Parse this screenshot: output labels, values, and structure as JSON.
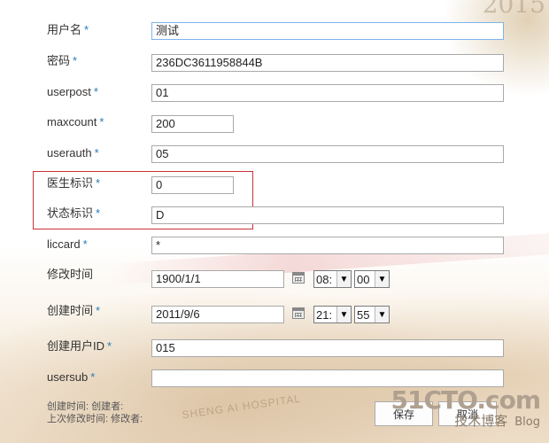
{
  "form": {
    "fields": [
      {
        "label": "用户名",
        "required": "*",
        "value": ""
      },
      {
        "label": "密码",
        "required": "*",
        "value": "236DC3611958844B"
      },
      {
        "label": "userpost",
        "required": "*",
        "value": "01"
      },
      {
        "label": "maxcount",
        "required": "*",
        "value": "200"
      },
      {
        "label": "userauth",
        "required": "*",
        "value": "05"
      },
      {
        "label": "医生标识",
        "required": "*",
        "value": "0"
      },
      {
        "label": "状态标识",
        "required": "*",
        "value": "D"
      },
      {
        "label": "liccard",
        "required": "*",
        "value": "*"
      },
      {
        "label": "修改时间",
        "required": "",
        "date": "1900/1/1",
        "hour": "08:",
        "minute": "00"
      },
      {
        "label": "创建时间",
        "required": "*",
        "date": "2011/9/6",
        "hour": "21:",
        "minute": "55"
      },
      {
        "label": "创建用户ID",
        "required": "*",
        "value": "015"
      },
      {
        "label": "usersub",
        "required": "*",
        "value": ""
      }
    ],
    "username_value": "测试"
  },
  "footer": {
    "created_line": "创建时间: 创建者:",
    "modified_line": "上次修改时间: 修改者:",
    "save_label": "保存",
    "cancel_label": "取消"
  },
  "background": {
    "year": "2015",
    "watermark_main": "51CTO.com",
    "watermark_sub": "技术博客",
    "watermark_blog": "Blog",
    "hospital_text": "SHENG AI HOSPITAL"
  },
  "colors": {
    "required_star": "#2a7ab8",
    "highlight_border": "#c8333a",
    "active_border": "#7eb4ea"
  }
}
